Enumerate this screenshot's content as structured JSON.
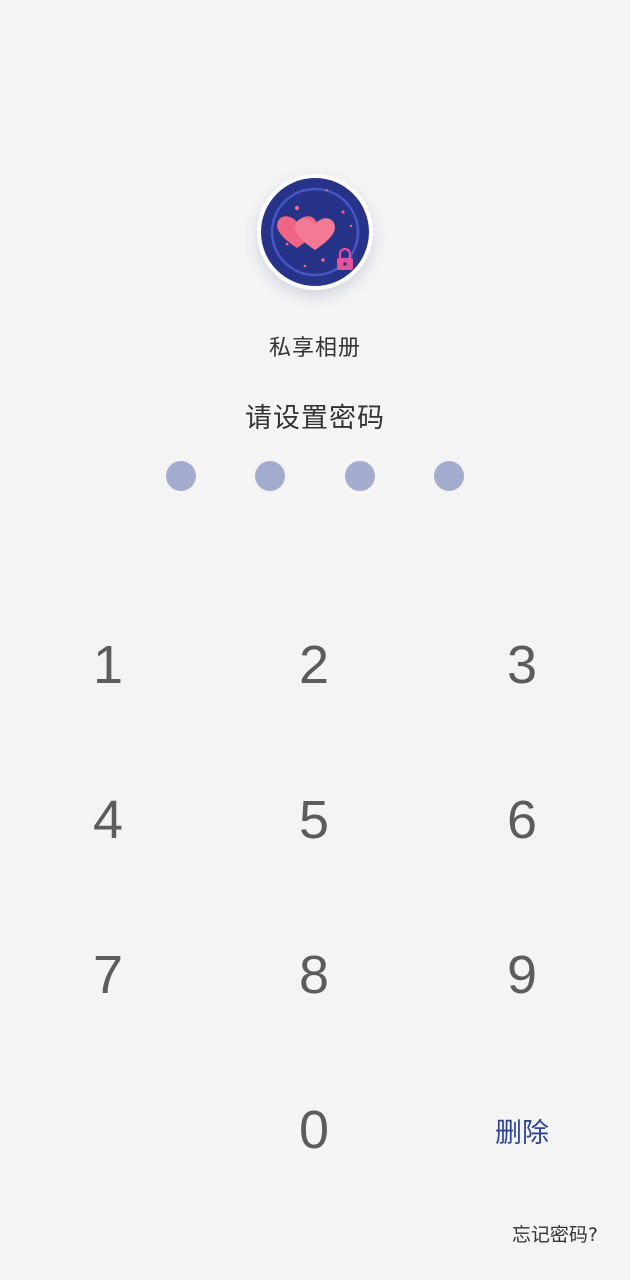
{
  "app": {
    "name": "私享相册",
    "icon": "hearts-lock-icon",
    "icon_colors": {
      "background": "#263389",
      "ring": "#4656c6",
      "heart": "#f06585",
      "lock": "#e0559a"
    }
  },
  "pin": {
    "prompt": "请设置密码",
    "length": 4,
    "entered": 0,
    "dot_color": "#a4acce"
  },
  "keypad": {
    "keys": [
      "1",
      "2",
      "3",
      "4",
      "5",
      "6",
      "7",
      "8",
      "9",
      "0"
    ],
    "delete_label": "删除",
    "delete_color": "#2e4596"
  },
  "forgot_password_label": "忘记密码?"
}
